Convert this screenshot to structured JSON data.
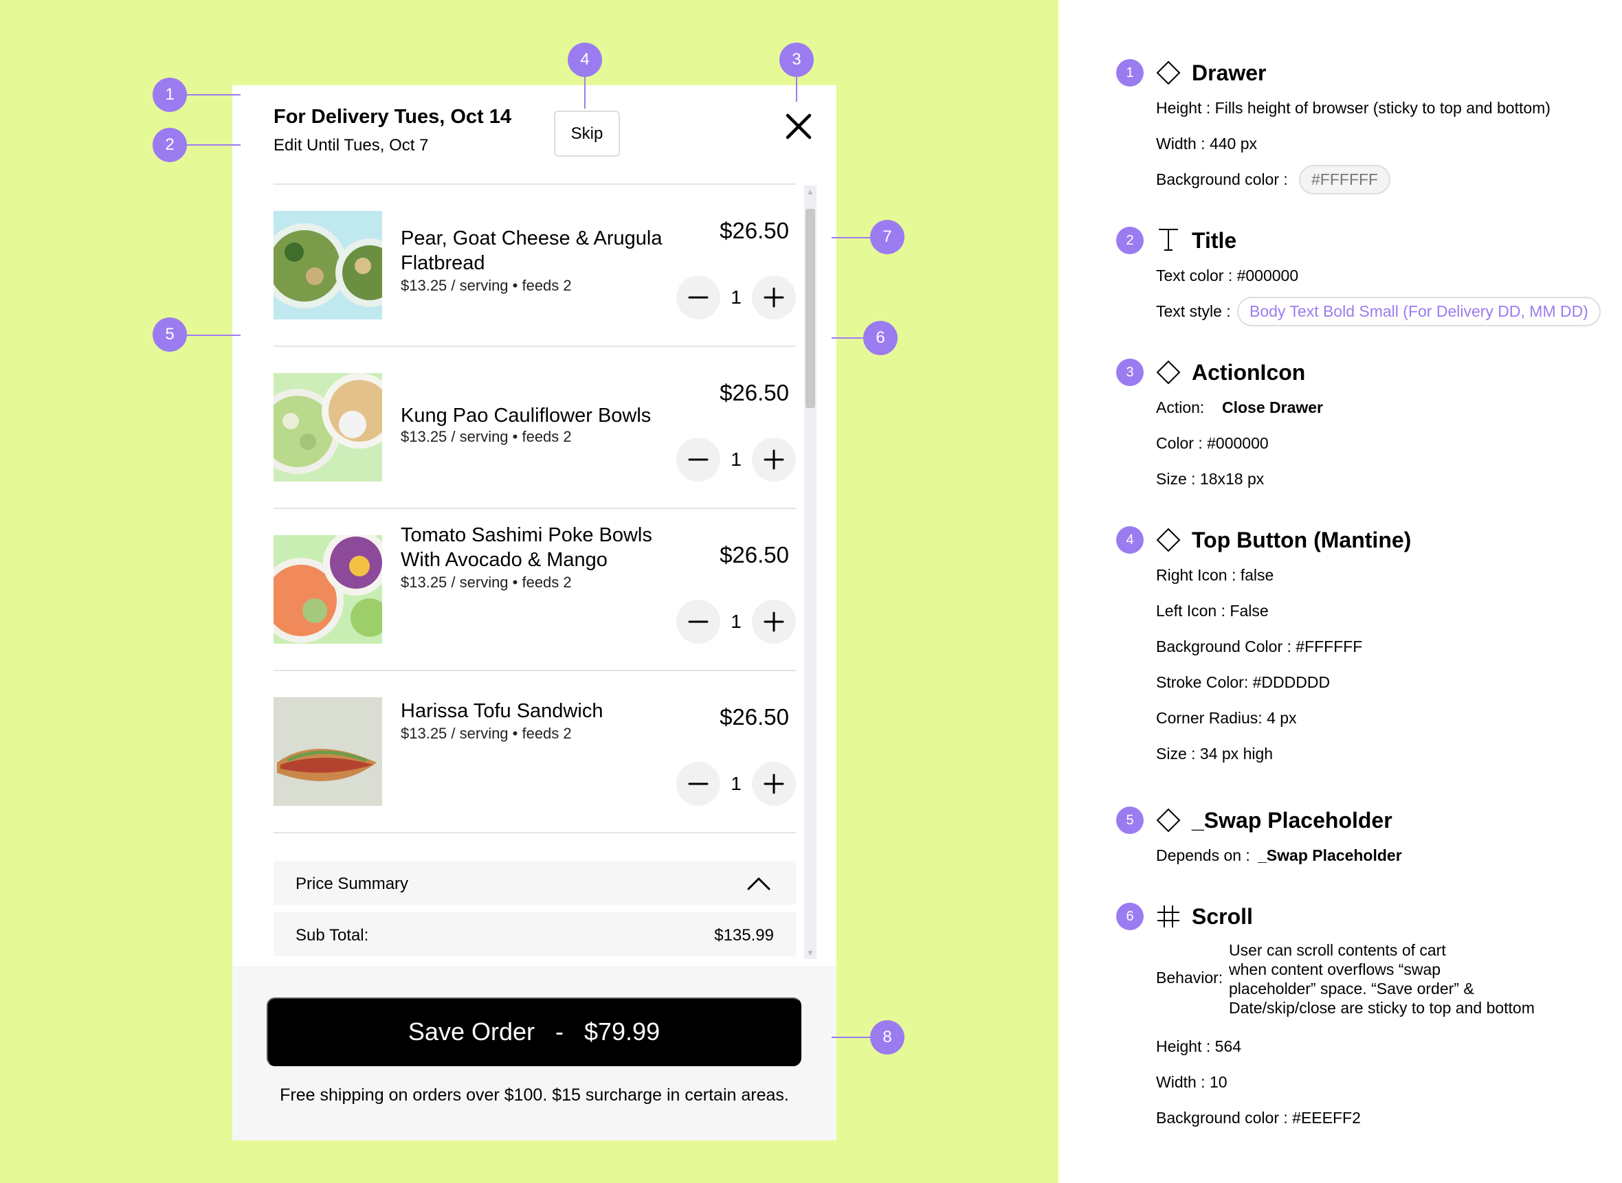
{
  "drawer": {
    "title": "For Delivery Tues, Oct 14",
    "subtitle": "Edit Until Tues, Oct 7",
    "skip_label": "Skip",
    "close_icon": "close-icon"
  },
  "items": [
    {
      "name": "Pear, Goat Cheese & Arugula Flatbread",
      "meta": "$13.25 / serving • feeds 2",
      "price": "$26.50",
      "qty": "1"
    },
    {
      "name": "Kung Pao Cauliflower Bowls",
      "meta": "$13.25 / serving • feeds 2",
      "price": "$26.50",
      "qty": "1"
    },
    {
      "name": "Tomato Sashimi Poke Bowls With Avocado & Mango",
      "meta": "$13.25 / serving • feeds 2",
      "price": "$26.50",
      "qty": "1"
    },
    {
      "name": "Harissa Tofu Sandwich",
      "meta": "$13.25 / serving • feeds 2",
      "price": "$26.50",
      "qty": "1"
    }
  ],
  "price_summary": {
    "label": "Price Summary",
    "subtotal_label": "Sub Total:",
    "subtotal_value": "$135.99"
  },
  "save_button": {
    "label": "Save Order   -   $79.99"
  },
  "shipping_note": "Free shipping on orders over $100. $15 surcharge in certain areas.",
  "markers": [
    "1",
    "2",
    "3",
    "4",
    "5",
    "6",
    "7",
    "8"
  ],
  "spec": {
    "drawer": {
      "num": "1",
      "title": "Drawer",
      "height": "Height :  Fills height of browser (sticky to top and bottom)",
      "width": "Width :  440 px",
      "bg_label": "Background color :",
      "bg_value": "#FFFFFF"
    },
    "title": {
      "num": "2",
      "title": "Title",
      "color": "Text color :  #000000",
      "style_label": "Text style :",
      "style_value": "Body Text Bold Small (For Delivery DD, MM DD)"
    },
    "action": {
      "num": "3",
      "title": "ActionIcon",
      "action_label": "Action:",
      "action_value": "Close Drawer",
      "color": "Color :  #000000",
      "size": "Size :  18x18 px"
    },
    "top_button": {
      "num": "4",
      "title": "Top Button (Mantine)",
      "right_icon": "Right Icon :  false",
      "left_icon": "Left Icon :  False",
      "bg": "Background Color :  #FFFFFF",
      "stroke": "Stroke Color:  #DDDDDD",
      "radius": "Corner Radius:  4 px",
      "size": "Size :  34 px high"
    },
    "swap": {
      "num": "5",
      "title": "_Swap Placeholder",
      "depends_label": "Depends on :",
      "depends_value": "_Swap Placeholder"
    },
    "scroll": {
      "num": "6",
      "title": "Scroll",
      "behavior_label": "Behavior:",
      "behavior_lines": [
        "User can scroll contents of cart",
        "when content overflows “swap",
        "placeholder” space. “Save order” &",
        "Date/skip/close are sticky to top and bottom"
      ],
      "height": "Height :  564",
      "width": "Width :  10",
      "bg": "Background color :  #EEEFF2"
    }
  },
  "colors": {
    "background": "#E5FA96",
    "accent": "#9B7CF0",
    "button": "#000000",
    "scroll": "#EEEFF2"
  }
}
